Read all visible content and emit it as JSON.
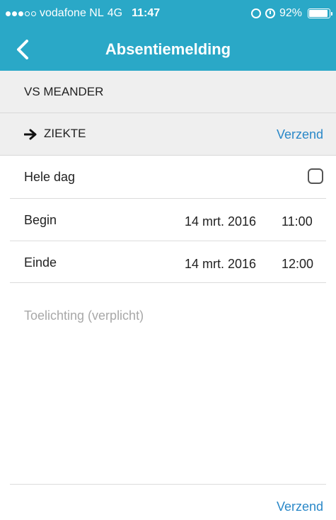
{
  "status_bar": {
    "carrier": "vodafone NL",
    "network": "4G",
    "time": "11:47",
    "battery": "92%",
    "battery_level": 0.92,
    "signal_bars_filled": 3,
    "signal_bars_total": 5,
    "icons": [
      "rotation-lock-icon",
      "alarm-icon",
      "battery-icon"
    ]
  },
  "nav": {
    "title": "Absentiemelding",
    "back_icon": "chevron-left-icon"
  },
  "school": {
    "name": "VS MEANDER"
  },
  "reason": {
    "label": "ZIEKTE",
    "icon": "arrow-right-icon",
    "send_label": "Verzend"
  },
  "form": {
    "all_day": {
      "label": "Hele dag",
      "checked": false
    },
    "begin": {
      "label": "Begin",
      "date": "14 mrt. 2016",
      "time": "11:00"
    },
    "end": {
      "label": "Einde",
      "date": "14 mrt. 2016",
      "time": "12:00"
    },
    "note": {
      "placeholder": "Toelichting (verplicht)",
      "value": ""
    }
  },
  "footer": {
    "send_label": "Verzend"
  },
  "colors": {
    "header_bg": "#2aa8c7",
    "link": "#2a88c8",
    "section_bg": "#efefef"
  }
}
